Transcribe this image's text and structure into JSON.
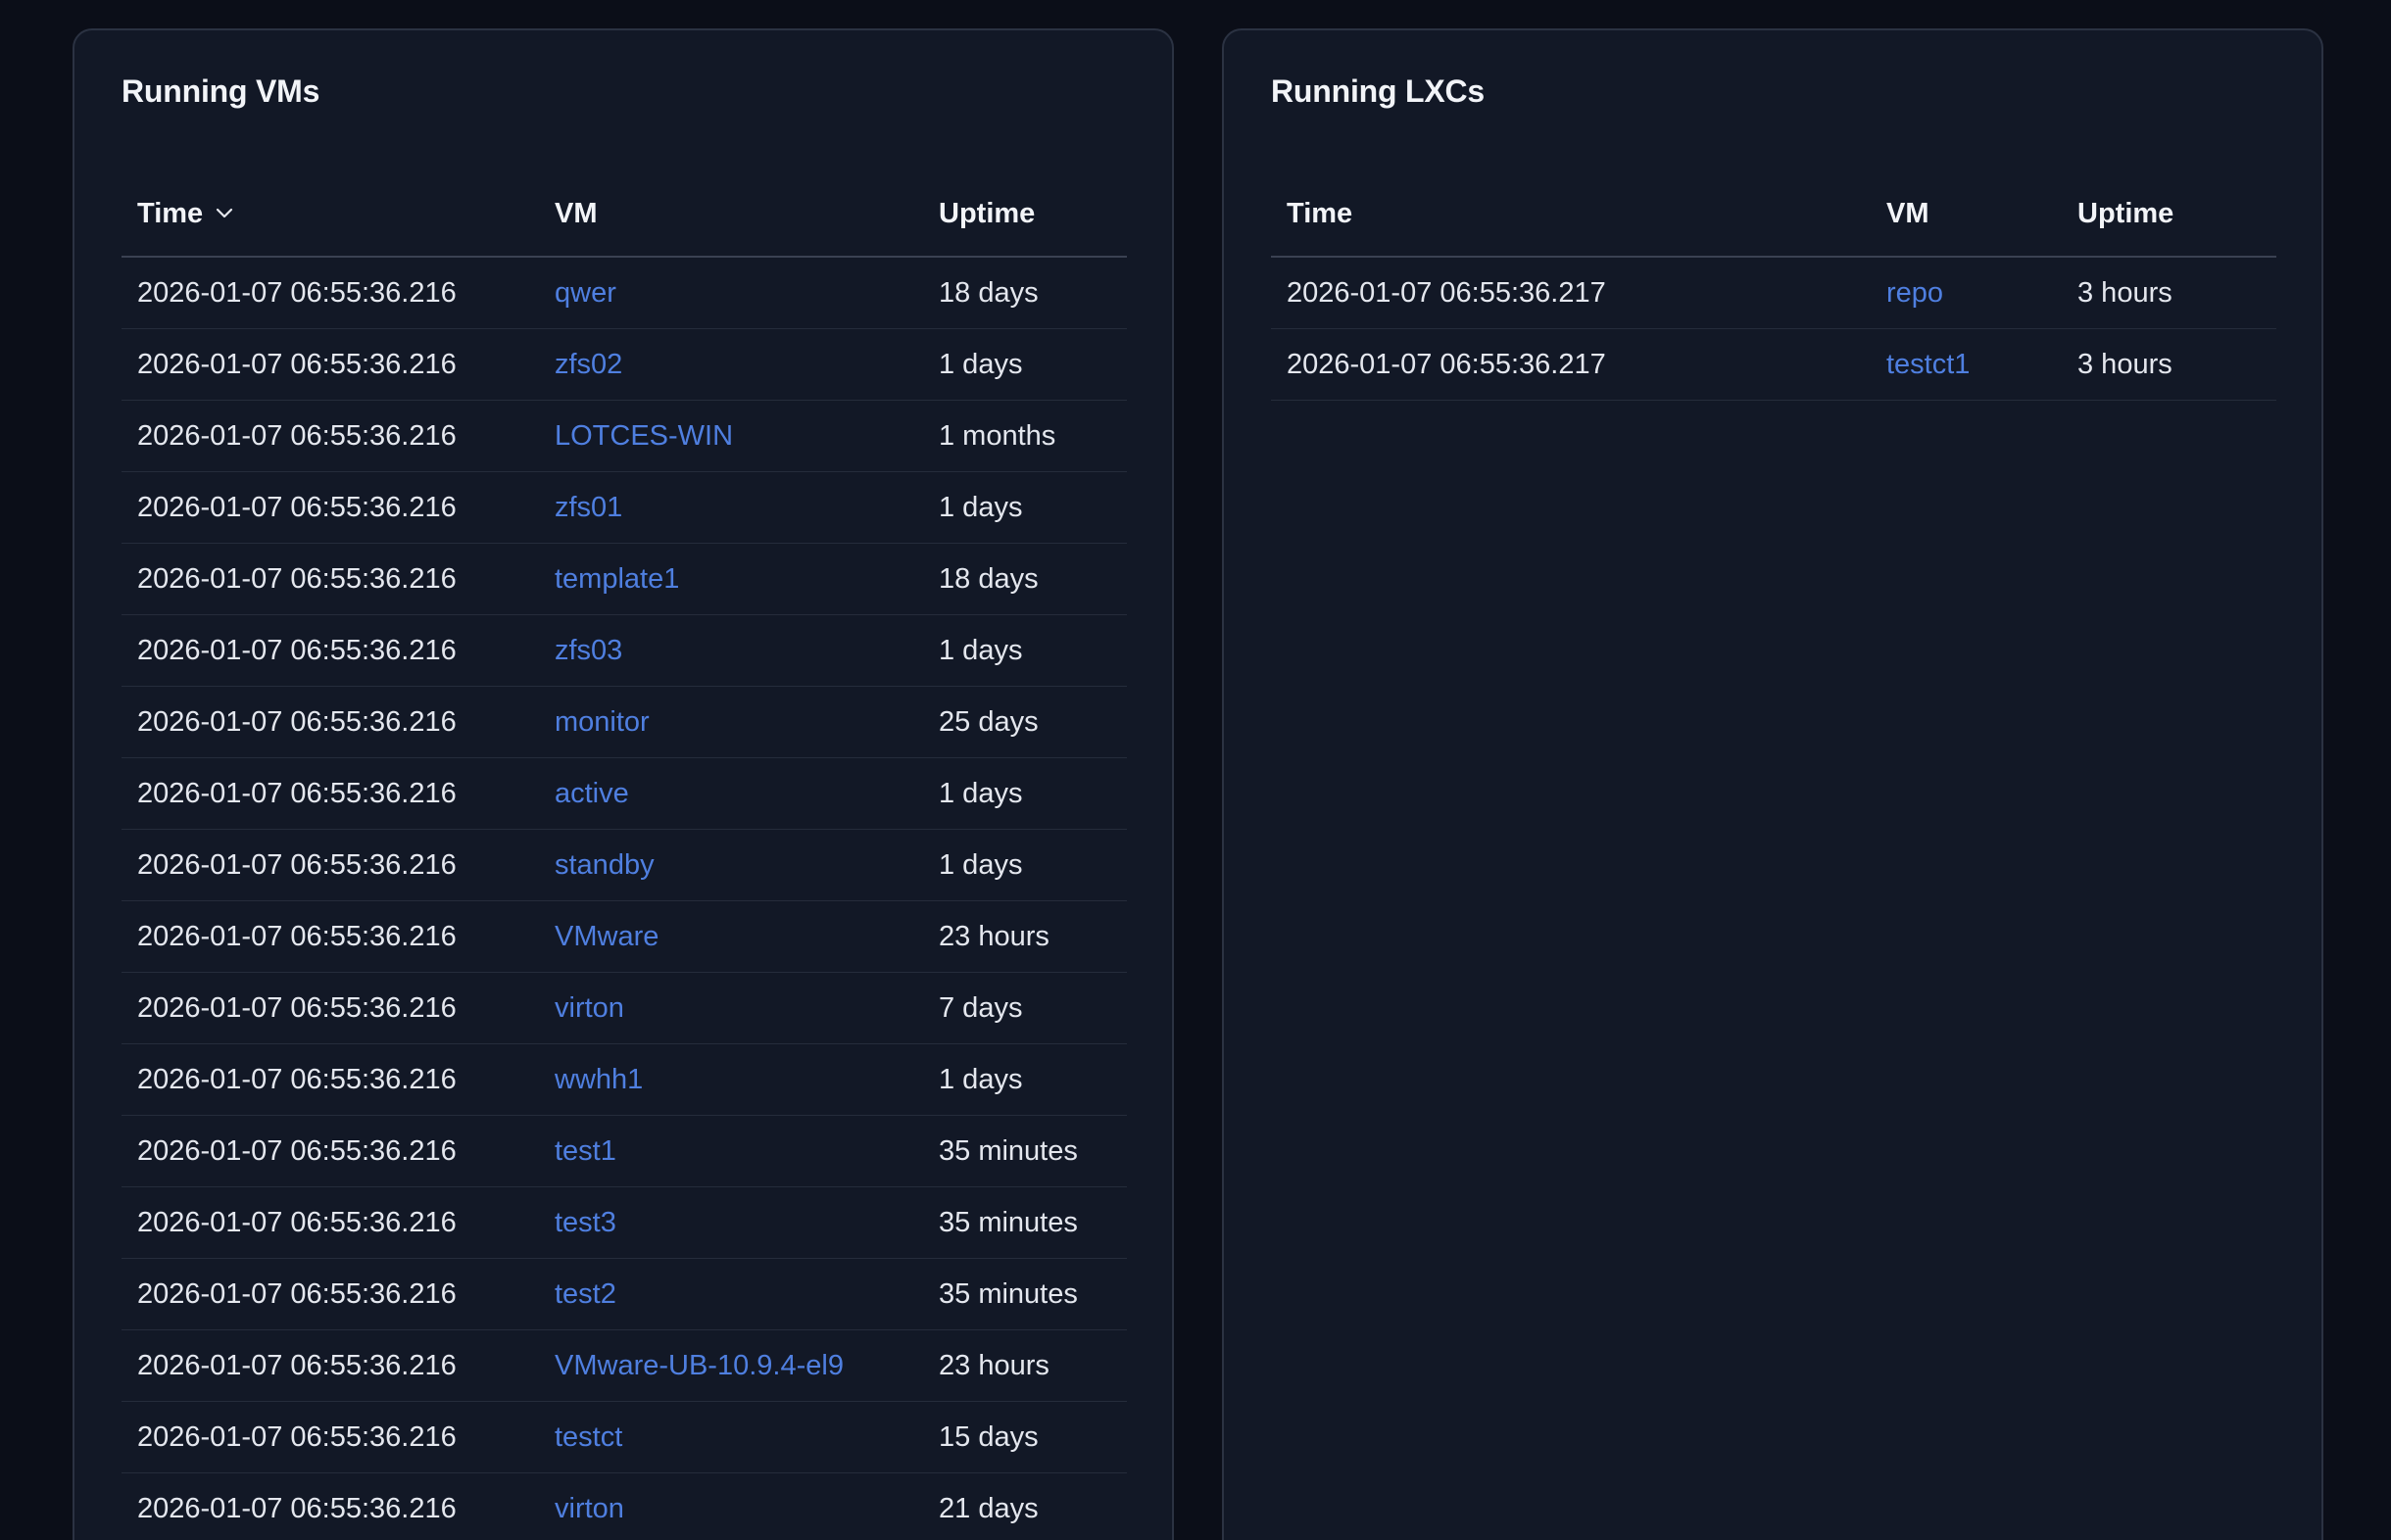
{
  "vms_panel": {
    "title": "Running VMs",
    "columns": {
      "time": "Time",
      "vm": "VM",
      "uptime": "Uptime"
    },
    "rows": [
      {
        "time": "2026-01-07 06:55:36.216",
        "vm": "qwer",
        "uptime": "18 days"
      },
      {
        "time": "2026-01-07 06:55:36.216",
        "vm": "zfs02",
        "uptime": "1 days"
      },
      {
        "time": "2026-01-07 06:55:36.216",
        "vm": "LOTCES-WIN",
        "uptime": "1 months"
      },
      {
        "time": "2026-01-07 06:55:36.216",
        "vm": "zfs01",
        "uptime": "1 days"
      },
      {
        "time": "2026-01-07 06:55:36.216",
        "vm": "template1",
        "uptime": "18 days"
      },
      {
        "time": "2026-01-07 06:55:36.216",
        "vm": "zfs03",
        "uptime": "1 days"
      },
      {
        "time": "2026-01-07 06:55:36.216",
        "vm": "monitor",
        "uptime": "25 days"
      },
      {
        "time": "2026-01-07 06:55:36.216",
        "vm": "active",
        "uptime": "1 days"
      },
      {
        "time": "2026-01-07 06:55:36.216",
        "vm": "standby",
        "uptime": "1 days"
      },
      {
        "time": "2026-01-07 06:55:36.216",
        "vm": "VMware",
        "uptime": "23 hours"
      },
      {
        "time": "2026-01-07 06:55:36.216",
        "vm": "virton",
        "uptime": "7 days"
      },
      {
        "time": "2026-01-07 06:55:36.216",
        "vm": "wwhh1",
        "uptime": "1 days"
      },
      {
        "time": "2026-01-07 06:55:36.216",
        "vm": "test1",
        "uptime": "35 minutes"
      },
      {
        "time": "2026-01-07 06:55:36.216",
        "vm": "test3",
        "uptime": "35 minutes"
      },
      {
        "time": "2026-01-07 06:55:36.216",
        "vm": "test2",
        "uptime": "35 minutes"
      },
      {
        "time": "2026-01-07 06:55:36.216",
        "vm": "VMware-UB-10.9.4-el9",
        "uptime": "23 hours"
      },
      {
        "time": "2026-01-07 06:55:36.216",
        "vm": "testct",
        "uptime": "15 days"
      },
      {
        "time": "2026-01-07 06:55:36.216",
        "vm": "virton",
        "uptime": "21 days"
      }
    ]
  },
  "lxcs_panel": {
    "title": "Running LXCs",
    "columns": {
      "time": "Time",
      "vm": "VM",
      "uptime": "Uptime"
    },
    "rows": [
      {
        "time": "2026-01-07 06:55:36.217",
        "vm": "repo",
        "uptime": "3 hours"
      },
      {
        "time": "2026-01-07 06:55:36.217",
        "vm": "testct1",
        "uptime": "3 hours"
      }
    ]
  },
  "icons": {
    "sort": "chevron-down-icon"
  },
  "colors": {
    "background": "#0b0e18",
    "panel": "#121826",
    "link": "#4f7fe0",
    "text": "#e4e7ee"
  }
}
